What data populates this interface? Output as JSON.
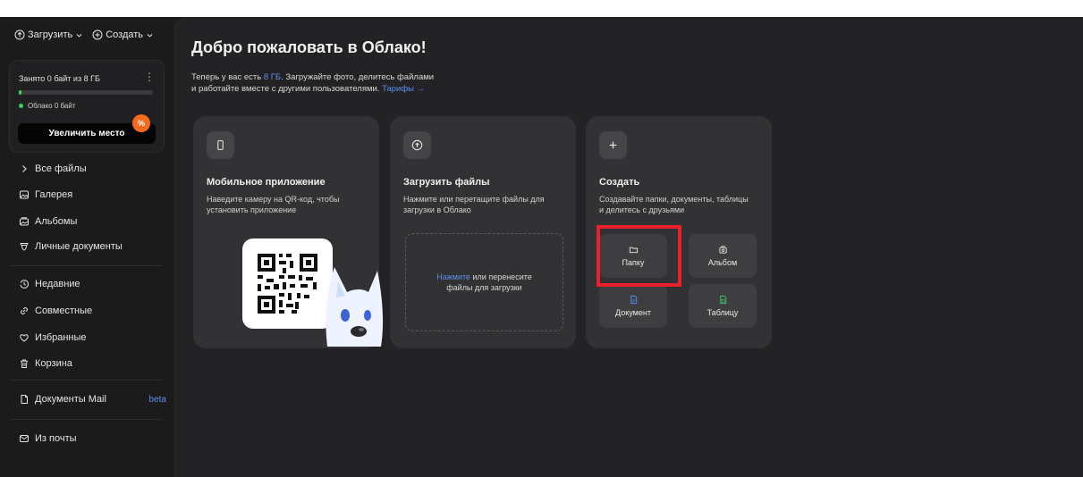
{
  "topbar": {
    "upload_label": "Загрузить",
    "create_label": "Создать"
  },
  "storage": {
    "used_text": "Занято 0 байт из 8 ГБ",
    "used_fraction": 0.0,
    "legend_text": "Облако 0 байт",
    "upgrade_label": "Увеличить место",
    "badge": "%",
    "accent_color": "#3ad05a"
  },
  "nav": {
    "items": [
      {
        "label": "Все файлы",
        "icon": "chevron-right-icon"
      },
      {
        "label": "Галерея",
        "icon": "gallery-icon"
      },
      {
        "label": "Альбомы",
        "icon": "albums-icon"
      },
      {
        "label": "Личные документы",
        "icon": "personal-docs-icon"
      },
      {
        "label": "Недавние",
        "icon": "recent-icon"
      },
      {
        "label": "Совместные",
        "icon": "shared-icon"
      },
      {
        "label": "Избранные",
        "icon": "heart-icon"
      },
      {
        "label": "Корзина",
        "icon": "trash-icon"
      },
      {
        "label": "Документы Mail",
        "icon": "document-icon",
        "tag": "beta"
      },
      {
        "label": "Из почты",
        "icon": "mail-icon"
      }
    ]
  },
  "welcome": {
    "title": "Добро пожаловать в Облако!",
    "line1_prefix": "Теперь у вас есть ",
    "line1_link": "8 ГБ",
    "line1_suffix": ". Загружайте фото, делитесь файлами",
    "line2_text": "и работайте вместе с другими пользователями. ",
    "line2_link": "Тарифы →"
  },
  "cards": {
    "mobile": {
      "title": "Мобильное приложение",
      "description": "Наведите камеру на QR-код, чтобы установить приложение",
      "icon": "phone-icon"
    },
    "upload": {
      "title": "Загрузить файлы",
      "description": "Нажмите или перетащите файлы для загрузки в Облако",
      "drop_link": "Нажмите",
      "drop_text_1": " или перенесите",
      "drop_text_2": "файлы для загрузки",
      "icon": "cloud-upload-icon"
    },
    "create": {
      "title": "Создать",
      "description": "Создавайте папки, документы, таблицы и делитесь с друзьями",
      "icon": "plus-icon",
      "tiles": [
        {
          "label": "Папку",
          "icon": "folder-icon",
          "color": "#e8e8e8"
        },
        {
          "label": "Альбом",
          "icon": "album-icon",
          "color": "#e8e8e8"
        },
        {
          "label": "Документ",
          "icon": "doc-icon",
          "color": "#4f8ef7"
        },
        {
          "label": "Таблицу",
          "icon": "table-icon",
          "color": "#3fbf6f"
        }
      ]
    }
  },
  "colors": {
    "link": "#5a8df0",
    "highlight": "#e8202a",
    "badge": "#f36a1d"
  }
}
